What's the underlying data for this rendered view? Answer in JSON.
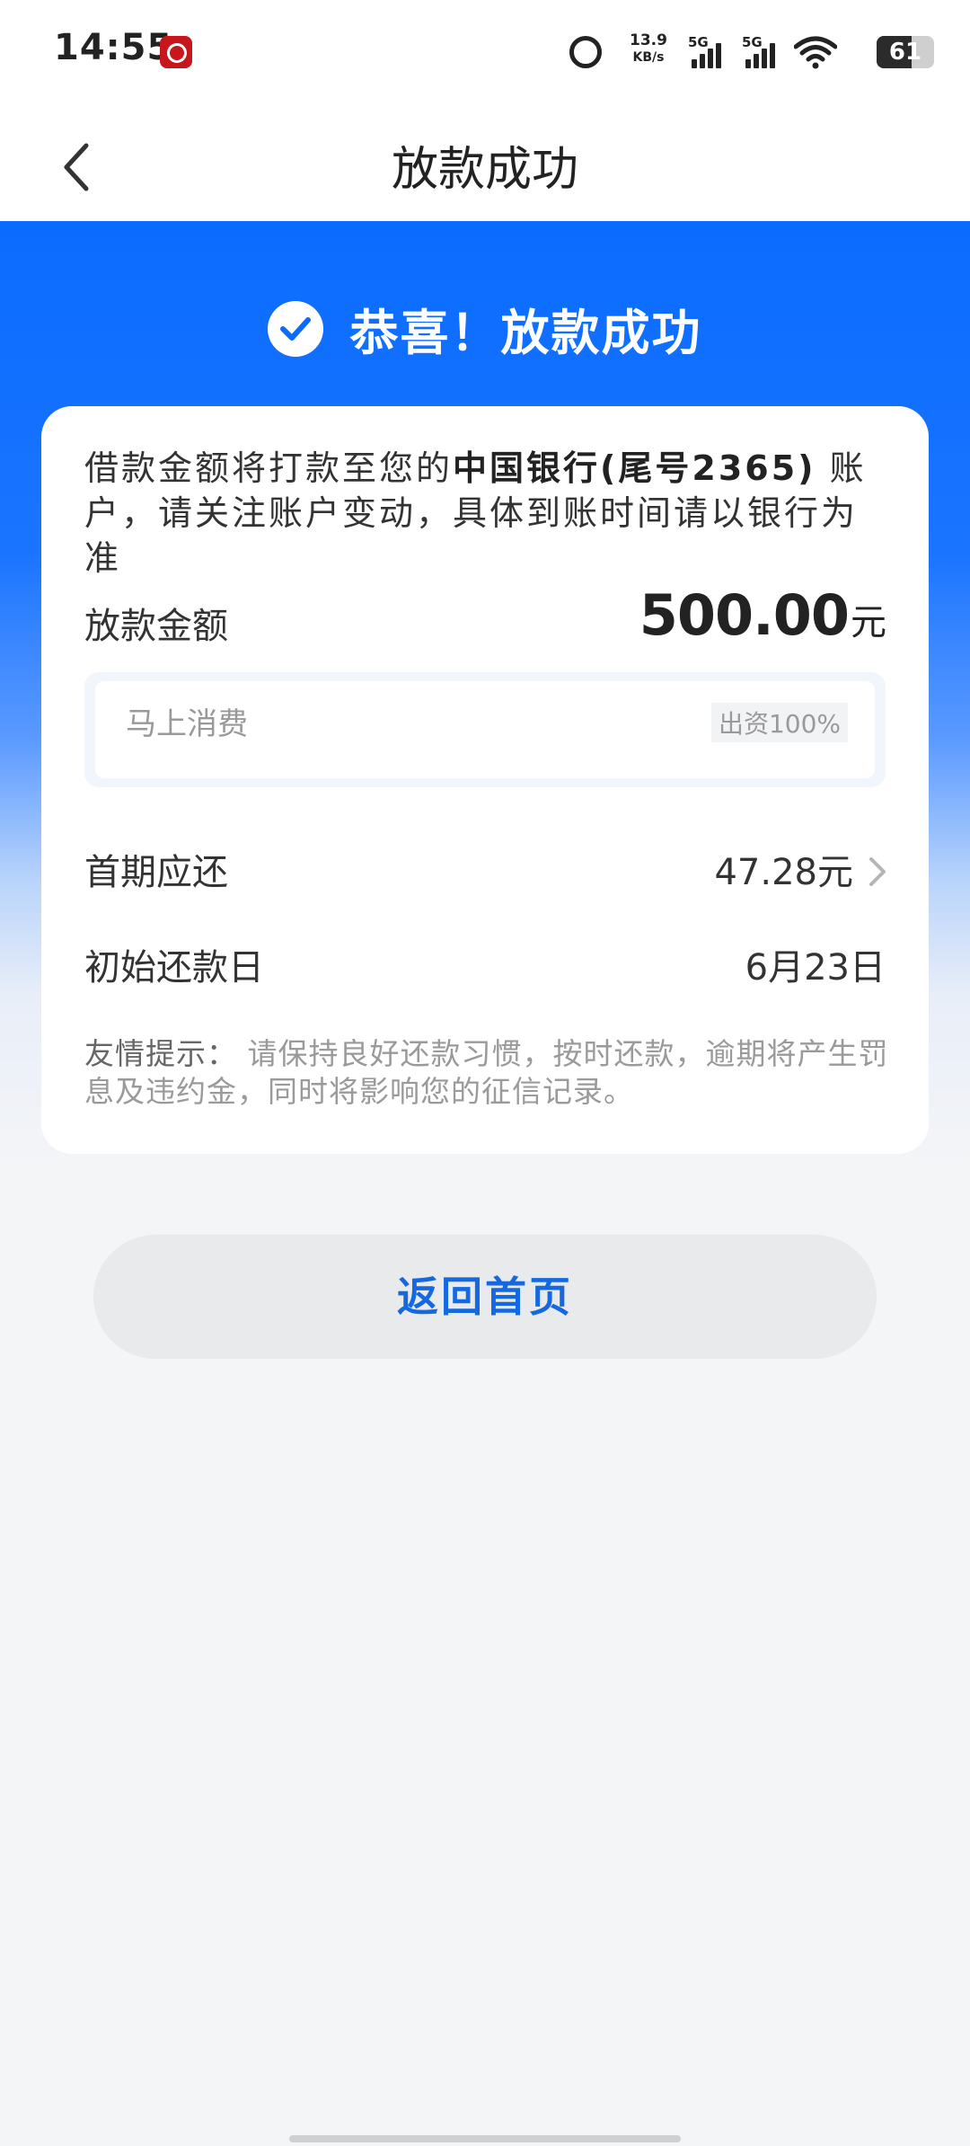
{
  "status_bar": {
    "time": "14:55",
    "net_speed": "13.9",
    "net_speed_unit": "KB/s",
    "signal_1": "5G",
    "signal_2": "5G",
    "battery": "61"
  },
  "nav": {
    "title": "放款成功"
  },
  "hero": {
    "title": "恭喜！放款成功"
  },
  "card": {
    "notice_pre": "借款金额将打款至您的",
    "notice_bank": "中国银行(尾号2365)",
    "notice_post": "账户，请关注账户变动，具体到账时间请以银行为准",
    "amount_label": "放款金额",
    "amount_value": "500.00",
    "amount_unit": "元",
    "lender_name": "马上消费",
    "lender_share": "出资100%",
    "first_payment_label": "首期应还",
    "first_payment_value": "47.28元",
    "start_date_label": "初始还款日",
    "start_date_value": "6月23日",
    "tip_label": "友情提示：",
    "tip_text": "请保持良好还款习惯，按时还款，逾期将产生罚息及违约金，同时将影响您的征信记录。"
  },
  "buttons": {
    "home": "返回首页"
  },
  "colors": {
    "brand_blue": "#0a6cff",
    "button_text": "#1569e0"
  }
}
